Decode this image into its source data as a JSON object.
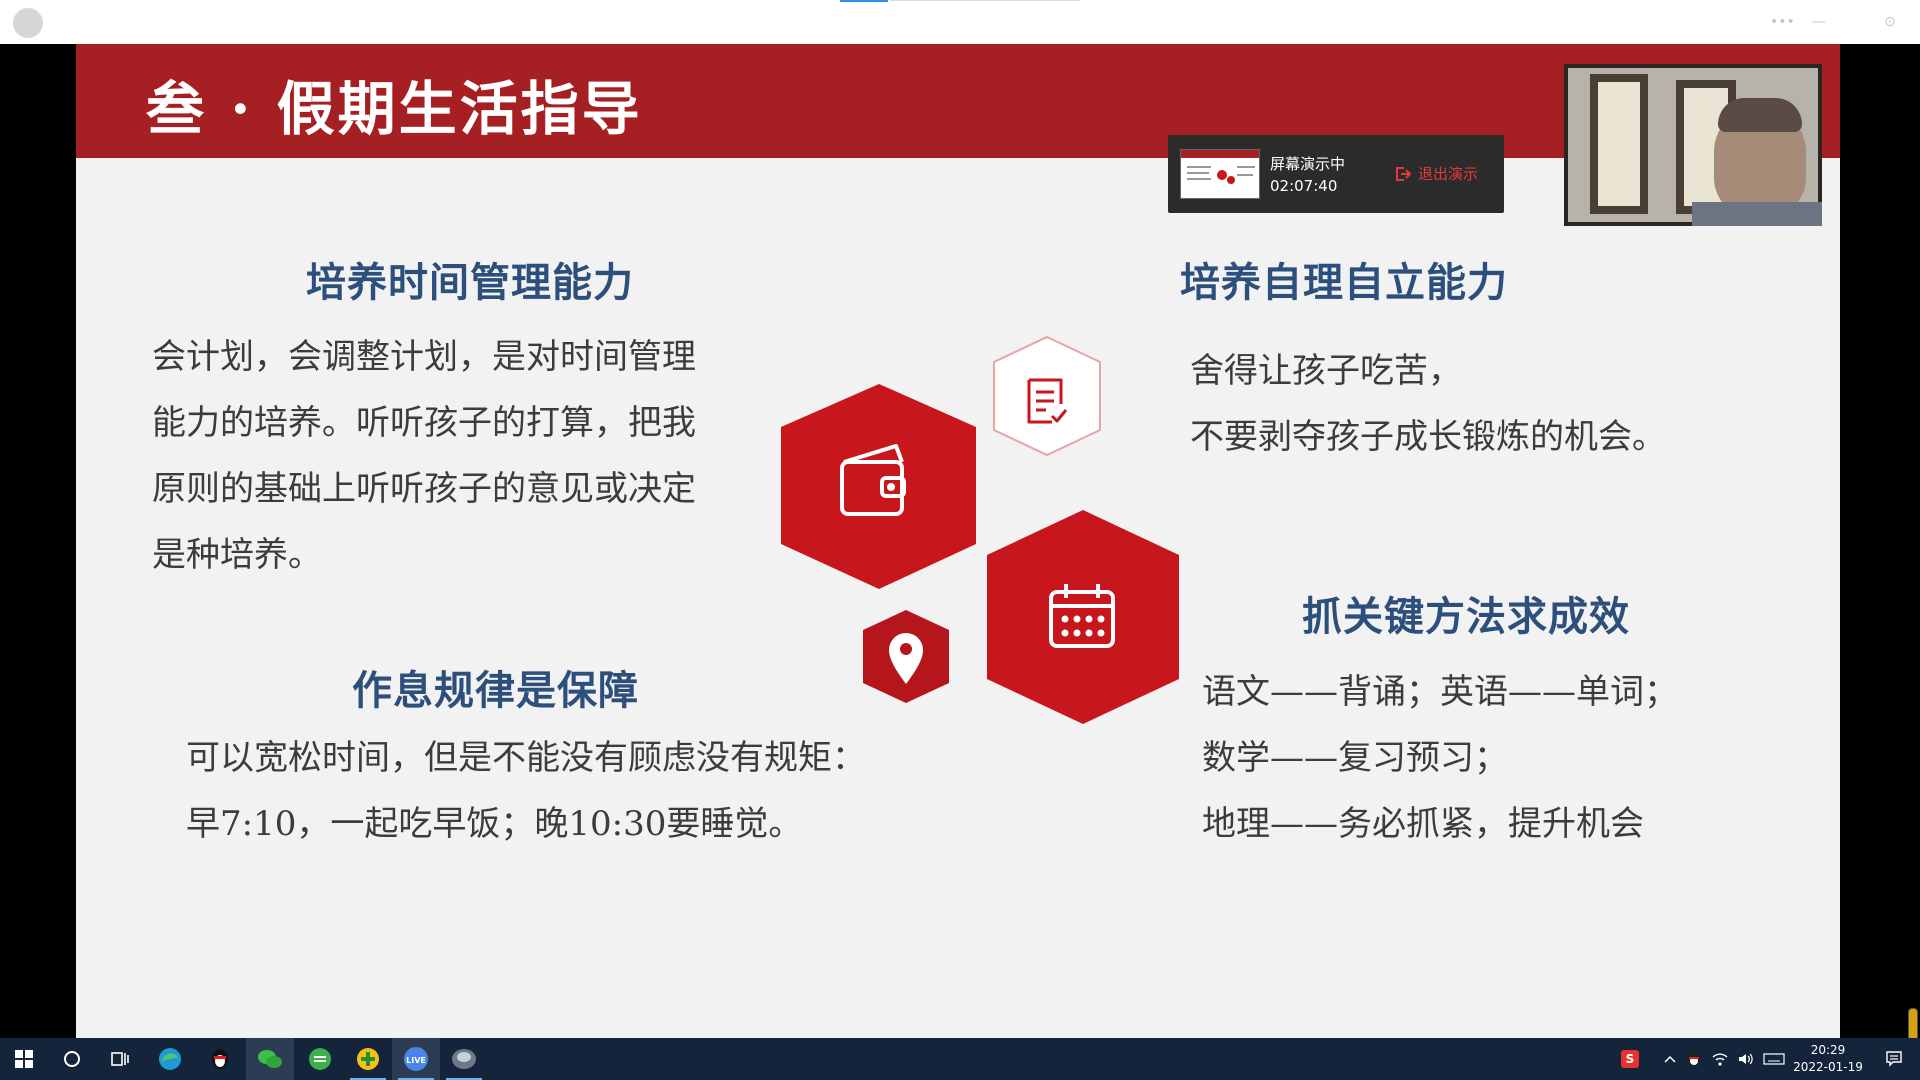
{
  "slide": {
    "title": "叁 · 假期生活指导",
    "sections": {
      "time_management": {
        "heading": "培养时间管理能力",
        "lines": [
          "会计划，会调整计划，是对时间管理",
          "能力的培养。听听孩子的打算，把我",
          "原则的基础上听听孩子的意见或决定",
          "是种培养。"
        ]
      },
      "self_reliance": {
        "heading": "培养自理自立能力",
        "lines": [
          "舍得让孩子吃苦，",
          "不要剥夺孩子成长锻炼的机会。"
        ]
      },
      "routine": {
        "heading": "作息规律是保障",
        "lines": [
          "可以宽松时间，但是不能没有顾虑没有规矩：",
          "早7:10，一起吃早饭；晚10:30要睡觉。"
        ]
      },
      "methods": {
        "heading": "抓关键方法求成效",
        "lines": [
          "语文——背诵；英语——单词；",
          "数学——复习预习；",
          "地理——务必抓紧，提升机会"
        ]
      }
    },
    "icons": [
      "wallet-icon",
      "document-check-icon",
      "calendar-icon",
      "location-pin-icon"
    ],
    "colors": {
      "banner": "#a61f23",
      "hexagon": "#c8161d",
      "heading": "#2d4f7c",
      "body_text": "#3c3c3c",
      "background": "#f2f2f3"
    }
  },
  "presentation_overlay": {
    "status": "屏幕演示中",
    "elapsed": "02:07:40",
    "exit_label": "退出演示"
  },
  "taskbar": {
    "apps": [
      "windows-start-icon",
      "search-icon",
      "task-view-icon",
      "edge-browser-icon",
      "qq-penguin-icon",
      "wechat-icon",
      "green-app-icon",
      "plus-app-icon",
      "live-app-icon",
      "meeting-app-icon"
    ],
    "live_label": "LIVE",
    "ime_label": "S",
    "clock_time": "20:29",
    "clock_date": "2022-01-19"
  }
}
